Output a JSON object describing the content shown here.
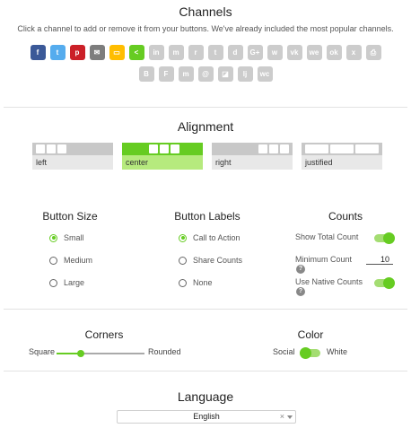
{
  "channels": {
    "title": "Channels",
    "subtitle": "Click a channel to add or remove it from your buttons. We've already included the most popular channels.",
    "row1": [
      {
        "name": "facebook-icon",
        "glyph": "f",
        "color": "#3b5998",
        "active": true
      },
      {
        "name": "twitter-icon",
        "glyph": "t",
        "color": "#55acee",
        "active": true
      },
      {
        "name": "pinterest-icon",
        "glyph": "p",
        "color": "#cb2027",
        "active": true
      },
      {
        "name": "email-icon",
        "glyph": "✉",
        "color": "#7d7d7d",
        "active": true
      },
      {
        "name": "sms-icon",
        "glyph": "▭",
        "color": "#ffbd00",
        "active": true
      },
      {
        "name": "sharethis-icon",
        "glyph": "<",
        "color": "#66cc22",
        "active": true
      },
      {
        "name": "linkedin-icon",
        "glyph": "in",
        "color": "#cccccc",
        "active": false
      },
      {
        "name": "messenger-icon",
        "glyph": "m",
        "color": "#cccccc",
        "active": false
      },
      {
        "name": "reddit-icon",
        "glyph": "r",
        "color": "#cccccc",
        "active": false
      },
      {
        "name": "tumblr-icon",
        "glyph": "t",
        "color": "#cccccc",
        "active": false
      },
      {
        "name": "digg-icon",
        "glyph": "d",
        "color": "#cccccc",
        "active": false
      },
      {
        "name": "googleplus-icon",
        "glyph": "G+",
        "color": "#cccccc",
        "active": false
      },
      {
        "name": "whatsapp-icon",
        "glyph": "w",
        "color": "#cccccc",
        "active": false
      },
      {
        "name": "vk-icon",
        "glyph": "vk",
        "color": "#cccccc",
        "active": false
      },
      {
        "name": "weibo-icon",
        "glyph": "we",
        "color": "#cccccc",
        "active": false
      },
      {
        "name": "odnoklassniki-icon",
        "glyph": "ok",
        "color": "#cccccc",
        "active": false
      },
      {
        "name": "xing-icon",
        "glyph": "x",
        "color": "#cccccc",
        "active": false
      },
      {
        "name": "print-icon",
        "glyph": "⎙",
        "color": "#cccccc",
        "active": false
      }
    ],
    "row2": [
      {
        "name": "blogger-icon",
        "glyph": "B",
        "color": "#cccccc",
        "active": false
      },
      {
        "name": "flipboard-icon",
        "glyph": "F",
        "color": "#cccccc",
        "active": false
      },
      {
        "name": "meneame-icon",
        "glyph": "m",
        "color": "#cccccc",
        "active": false
      },
      {
        "name": "mailru-icon",
        "glyph": "@",
        "color": "#cccccc",
        "active": false
      },
      {
        "name": "delicious-icon",
        "glyph": "◪",
        "color": "#cccccc",
        "active": false
      },
      {
        "name": "livejournal-icon",
        "glyph": "lj",
        "color": "#cccccc",
        "active": false
      },
      {
        "name": "wechat-icon",
        "glyph": "wc",
        "color": "#cccccc",
        "active": false
      }
    ]
  },
  "alignment": {
    "title": "Alignment",
    "options": [
      {
        "label": "left",
        "selected": false
      },
      {
        "label": "center",
        "selected": true
      },
      {
        "label": "right",
        "selected": false
      },
      {
        "label": "justified",
        "selected": false
      }
    ]
  },
  "button_size": {
    "title": "Button Size",
    "options": [
      {
        "label": "Small",
        "selected": true
      },
      {
        "label": "Medium",
        "selected": false
      },
      {
        "label": "Large",
        "selected": false
      }
    ]
  },
  "button_labels": {
    "title": "Button Labels",
    "options": [
      {
        "label": "Call to Action",
        "selected": true
      },
      {
        "label": "Share Counts",
        "selected": false
      },
      {
        "label": "None",
        "selected": false
      }
    ]
  },
  "counts": {
    "title": "Counts",
    "show_total_label": "Show Total Count",
    "show_total_on": true,
    "minimum_label": "Minimum Count",
    "minimum_value": "10",
    "native_label": "Use Native Counts",
    "native_on": true,
    "help_glyph": "?"
  },
  "corners": {
    "title": "Corners",
    "left_label": "Square",
    "right_label": "Rounded",
    "value_fraction": 0.28
  },
  "color": {
    "title": "Color",
    "left_label": "Social",
    "right_label": "White",
    "social_selected": true
  },
  "language": {
    "title": "Language",
    "selected": "English",
    "clear_glyph": "×"
  }
}
